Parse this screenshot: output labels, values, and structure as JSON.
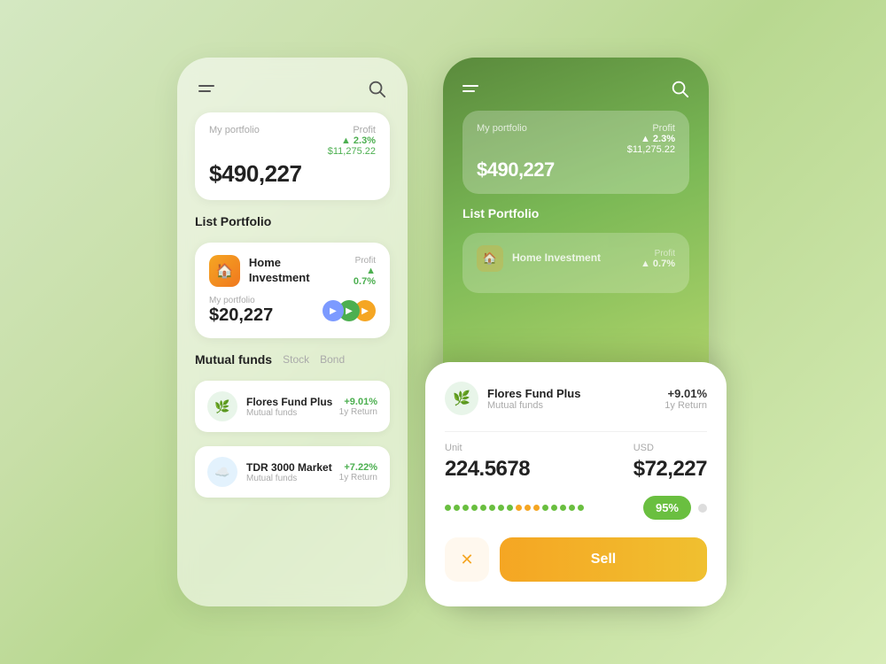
{
  "left_phone": {
    "portfolio": {
      "label": "My portfolio",
      "value": "$490,227",
      "profit_label": "Profit",
      "profit_percent": "▲ 2.3%",
      "profit_amount": "$11,275.22"
    },
    "list_portfolio_title": "List Portfolio",
    "home_investment": {
      "name": "Home Investment",
      "profit_label": "Profit",
      "profit_percent": "▲ 0.7%",
      "portfolio_label": "My portfolio",
      "portfolio_value": "$20,227"
    },
    "mutual_funds": {
      "title": "Mutual funds",
      "tabs": [
        "Stock",
        "Bond"
      ],
      "funds": [
        {
          "name": "Flores Fund Plus",
          "type": "Mutual funds",
          "return_percent": "+9.01%",
          "return_label": "1y Return",
          "icon": "🌿"
        },
        {
          "name": "TDR 3000 Market",
          "type": "Mutual funds",
          "return_percent": "+7.22%",
          "return_label": "1y Return",
          "icon": "☁️"
        }
      ]
    }
  },
  "right_phone": {
    "portfolio": {
      "label": "My portfolio",
      "value": "$490,227",
      "profit_label": "Profit",
      "profit_percent": "▲ 2.3%",
      "profit_amount": "$11,275.22"
    },
    "list_portfolio_title": "List Portfolio",
    "home_investment": {
      "name": "Home Investment",
      "profit_label": "Profit",
      "profit_percent": "▲ 0.7%"
    }
  },
  "bottom_sheet": {
    "fund_name": "Flores Fund Plus",
    "fund_type": "Mutual funds",
    "return_percent": "+9.01%",
    "return_label": "1y Return",
    "unit_label": "Unit",
    "unit_value": "224.5678",
    "usd_label": "USD",
    "usd_value": "$72,227",
    "progress_value": "95%",
    "cancel_label": "✕",
    "sell_label": "Sell"
  }
}
